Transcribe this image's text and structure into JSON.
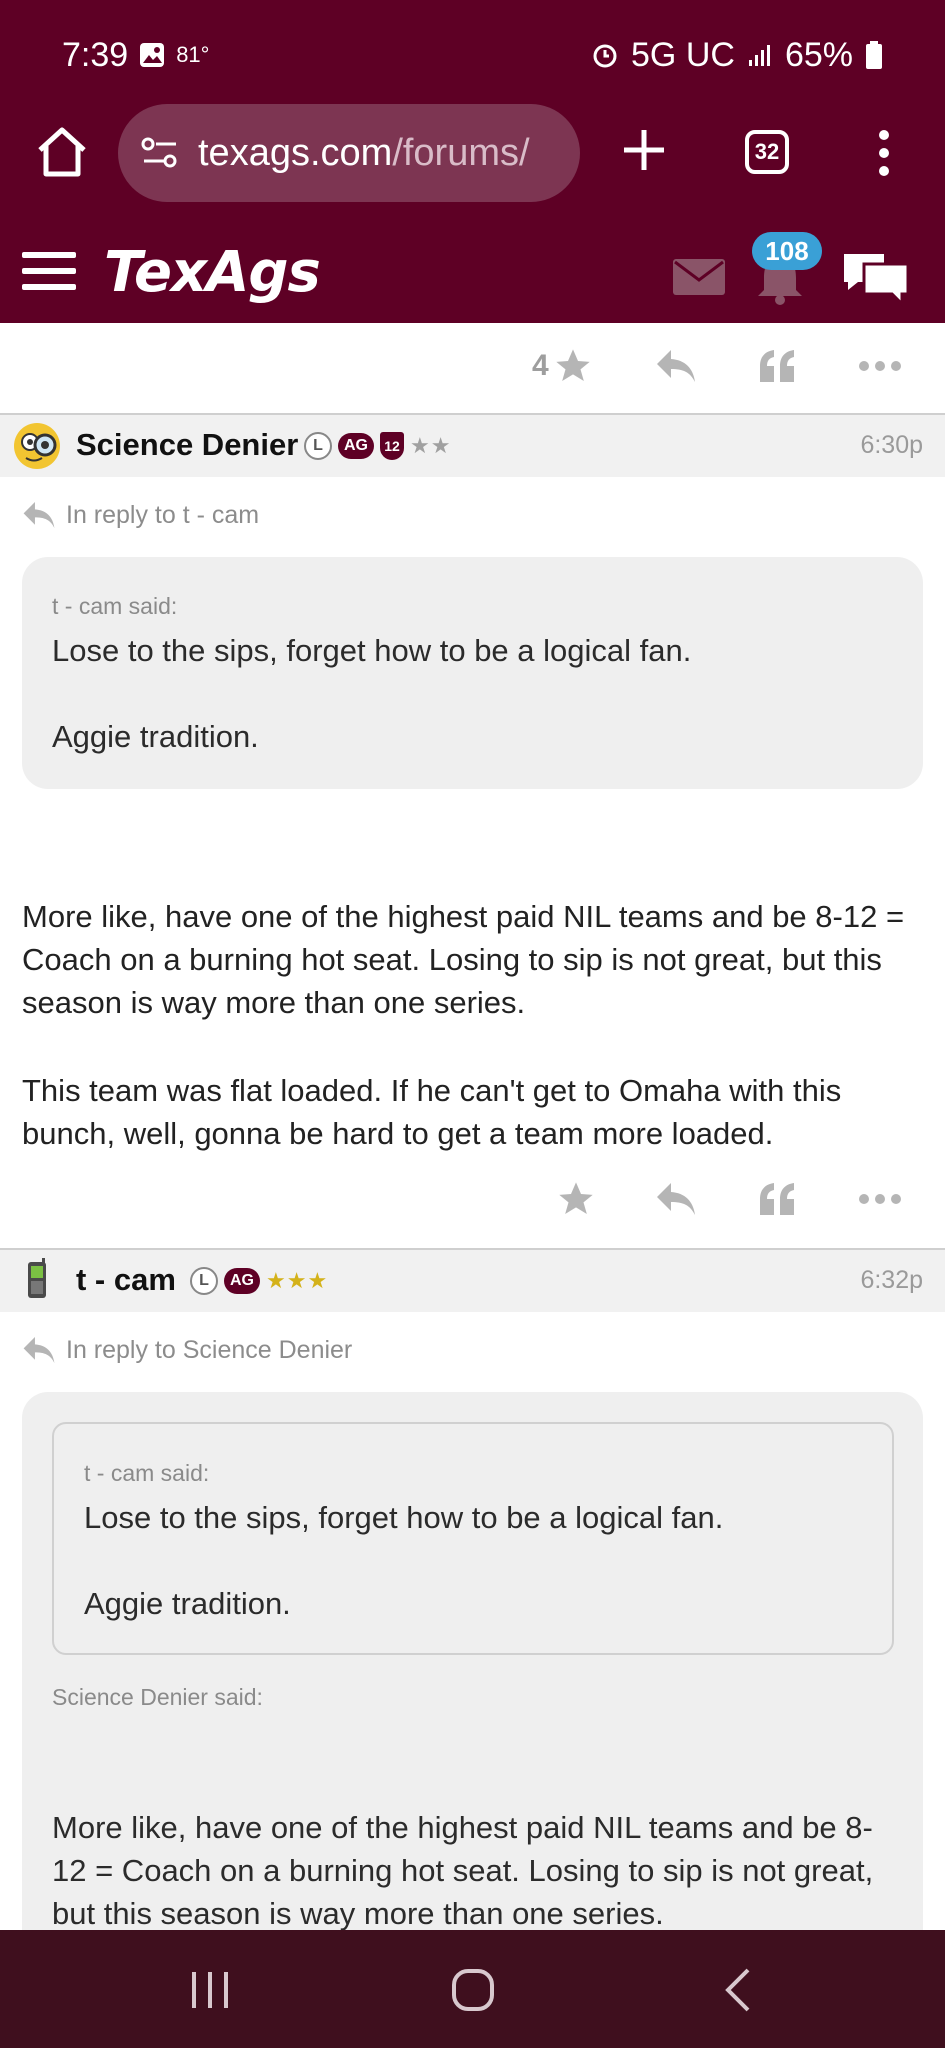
{
  "status_bar": {
    "time": "7:39",
    "temp": "81°",
    "network": "5G UC",
    "battery": "65%"
  },
  "browser": {
    "url_domain": "texags.com",
    "url_path": "/forums/",
    "tab_count": "32"
  },
  "site": {
    "logo": "TexAgs",
    "notification_count": "108"
  },
  "top_actions": {
    "star_count": "4"
  },
  "posts": [
    {
      "author": "Science Denier",
      "badge_l": "L",
      "badge_ag": "AG",
      "badge_year": "12",
      "stars": "★★",
      "time": "6:30p",
      "in_reply_to": "In reply to t - cam",
      "quote_said": "t - cam said:",
      "quote_line1": "Lose to the sips, forget how to be a logical fan.",
      "quote_line2": "Aggie tradition.",
      "body_p1": "More like, have one of the highest paid NIL teams and be 8-12 = Coach on a burning hot seat. Losing to sip is not great, but this season is way more than one series.",
      "body_p2": "This team was flat loaded. If he can't get to Omaha with this bunch, well, gonna be hard to get a team more loaded."
    },
    {
      "author": "t - cam",
      "badge_l": "L",
      "badge_ag": "AG",
      "stars": "★★★",
      "time": "6:32p",
      "in_reply_to": "In reply to Science Denier",
      "inner_said": "t - cam said:",
      "inner_line1": "Lose to the sips, forget how to be a logical fan.",
      "inner_line2": "Aggie tradition.",
      "quote_said": "Science Denier said:",
      "quote_body": "More like, have one of the highest paid NIL teams and be 8-12 = Coach on a burning hot seat. Losing to sip is not great, but this season is way more than one series."
    }
  ],
  "colors": {
    "brand": "#5e0025",
    "badge_blue": "#3aa0d6",
    "star_gold": "#d4b21a"
  }
}
